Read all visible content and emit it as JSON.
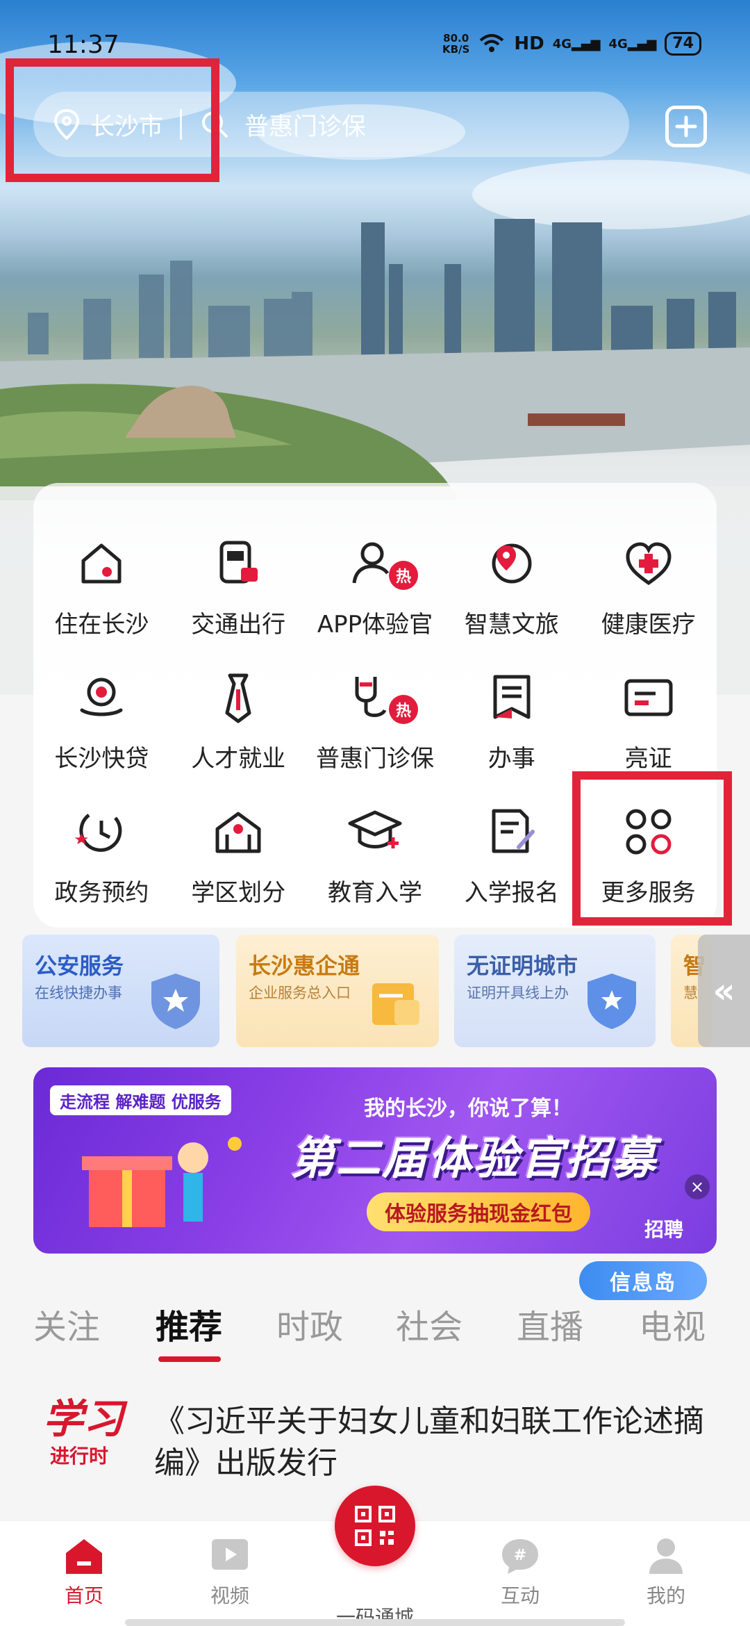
{
  "status_bar": {
    "time": "11:37",
    "net_speed_value": "80.0",
    "net_speed_unit": "KB/S",
    "hd_label": "HD",
    "signal1": "4G",
    "signal2": "4G",
    "battery": "74"
  },
  "header": {
    "location": "长沙市",
    "search_placeholder": "普惠门诊保"
  },
  "services": [
    {
      "label": "住在长沙",
      "icon": "home-pin-icon",
      "hot": false
    },
    {
      "label": "交通出行",
      "icon": "transit-icon",
      "hot": false
    },
    {
      "label": "APP体验官",
      "icon": "user-icon",
      "hot": true
    },
    {
      "label": "智慧文旅",
      "icon": "travel-pin-icon",
      "hot": false
    },
    {
      "label": "健康医疗",
      "icon": "heart-plus-icon",
      "hot": false
    },
    {
      "label": "长沙快贷",
      "icon": "money-hand-icon",
      "hot": false
    },
    {
      "label": "人才就业",
      "icon": "tie-icon",
      "hot": false
    },
    {
      "label": "普惠门诊保",
      "icon": "stethoscope-icon",
      "hot": true
    },
    {
      "label": "办事",
      "icon": "flag-doc-icon",
      "hot": false
    },
    {
      "label": "亮证",
      "icon": "id-card-icon",
      "hot": false
    },
    {
      "label": "政务预约",
      "icon": "clock-icon",
      "hot": false
    },
    {
      "label": "学区划分",
      "icon": "school-icon",
      "hot": false
    },
    {
      "label": "教育入学",
      "icon": "graduation-cap-icon",
      "hot": false
    },
    {
      "label": "入学报名",
      "icon": "edit-doc-icon",
      "hot": false
    },
    {
      "label": "更多服务",
      "icon": "more-services-icon",
      "hot": false
    }
  ],
  "hot_badge": "热",
  "categories": [
    {
      "title": "公安服务",
      "subtitle": "在线快捷办事"
    },
    {
      "title": "长沙惠企通",
      "subtitle": "企业服务总入口"
    },
    {
      "title": "无证明城市",
      "subtitle": "证明开具线上办"
    },
    {
      "title": "智",
      "subtitle": "慧"
    }
  ],
  "banner": {
    "pill": "走流程 解难题 优服务",
    "subtitle": "我的长沙，你说了算！",
    "title": "第二届体验官招募",
    "prize": "体验服务抽现金红包",
    "recruit": "招聘",
    "info_island": "信息岛"
  },
  "tabs": [
    {
      "label": "关注",
      "active": false
    },
    {
      "label": "推荐",
      "active": true
    },
    {
      "label": "时政",
      "active": false
    },
    {
      "label": "社会",
      "active": false
    },
    {
      "label": "直播",
      "active": false
    },
    {
      "label": "电视",
      "active": false
    }
  ],
  "news": {
    "logo_line1": "学习",
    "logo_line2": "进行时",
    "title": "《习近平关于妇女儿童和妇联工作论述摘编》出版发行"
  },
  "bottom_nav": [
    {
      "label": "首页",
      "active": true
    },
    {
      "label": "视频",
      "active": false
    },
    {
      "label": "一码通城",
      "active": false
    },
    {
      "label": "互动",
      "active": false
    },
    {
      "label": "我的",
      "active": false
    }
  ],
  "colors": {
    "accent": "#d8172d",
    "highlight": "#e0243a"
  }
}
